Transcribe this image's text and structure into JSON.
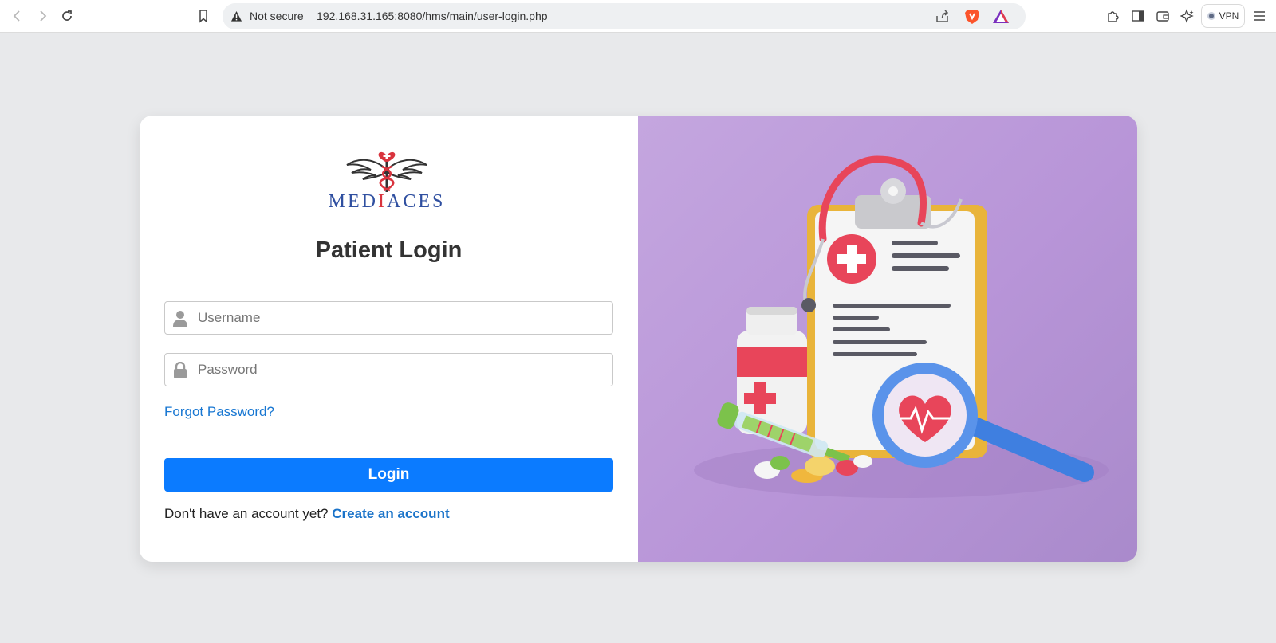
{
  "browser": {
    "security_label": "Not secure",
    "url": "192.168.31.165:8080/hms/main/user-login.php",
    "vpn_label": "VPN",
    "icons": [
      "back-icon",
      "forward-icon",
      "reload-icon",
      "bookmark-icon",
      "warning-icon",
      "share-icon",
      "brave-shields-icon",
      "brave-rewards-icon",
      "extensions-icon",
      "sidebar-icon",
      "wallet-icon",
      "leo-ai-icon",
      "vpn-icon",
      "menu-icon"
    ]
  },
  "logo": {
    "brand_text": "MEDIACES"
  },
  "login": {
    "title": "Patient Login",
    "username_placeholder": "Username",
    "password_placeholder": "Password",
    "forgot_link": "Forgot Password?",
    "submit_label": "Login",
    "signup_prompt": "Don't have an account yet?",
    "signup_link": "Create an account"
  },
  "colors": {
    "accent": "#0b7bff",
    "link": "#1877d2",
    "illustration_bg": "#bc9cdc"
  }
}
